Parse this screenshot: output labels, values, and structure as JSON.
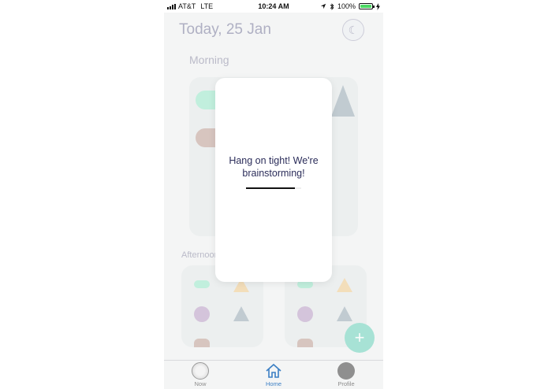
{
  "status_bar": {
    "carrier": "AT&T",
    "network": "LTE",
    "time": "10:24 AM",
    "battery_percent": "100%",
    "battery_level": 1.0,
    "icons": [
      "signal-bars-icon",
      "location-arrow-icon",
      "bluetooth-icon",
      "battery-icon",
      "charging-bolt-icon"
    ]
  },
  "header": {
    "date_title": "Today, 25 Jan",
    "avatar_icon": "moon-avatar-icon"
  },
  "sections": {
    "morning_label": "Morning",
    "afternoon_label": "Afternoon"
  },
  "shapes": {
    "colors": {
      "green": "#a6eccf",
      "brown": "#c8aba2",
      "slate": "#a7b4bd",
      "yellow": "#f3d29a",
      "purple": "#c3a9cc"
    }
  },
  "modal": {
    "message": "Hang on tight! We're brainstorming!",
    "progress": 0.88
  },
  "fab": {
    "symbol": "+",
    "icon": "plus-icon"
  },
  "tabbar": {
    "tabs": [
      {
        "label": "Now",
        "icon": "moon-icon",
        "active": false
      },
      {
        "label": "Home",
        "icon": "home-icon",
        "active": true
      },
      {
        "label": "Profile",
        "icon": "profile-avatar-icon",
        "active": false
      }
    ],
    "active_color": "#3b7fc4"
  }
}
